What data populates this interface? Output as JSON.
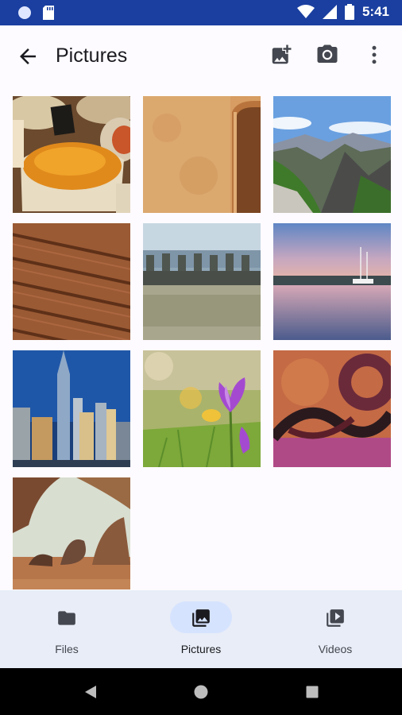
{
  "status_bar": {
    "time": "5:41"
  },
  "app_bar": {
    "title": "Pictures"
  },
  "photos": [
    "spices",
    "sandstone-wall",
    "mountains",
    "wood-deck",
    "ocean-pool",
    "harbor-sunset",
    "city-skyline",
    "purple-flowers",
    "abstract-swirl",
    "desert-rocks"
  ],
  "bottom_nav": [
    {
      "label": "Files",
      "icon": "folder-icon",
      "active": false
    },
    {
      "label": "Pictures",
      "icon": "photo-library-icon",
      "active": true
    },
    {
      "label": "Videos",
      "icon": "video-library-icon",
      "active": false
    }
  ],
  "colors": {
    "status_bar": "#1a3fa0",
    "accent_pill": "#d6e3ff",
    "nav_bg": "#e8edf7"
  }
}
